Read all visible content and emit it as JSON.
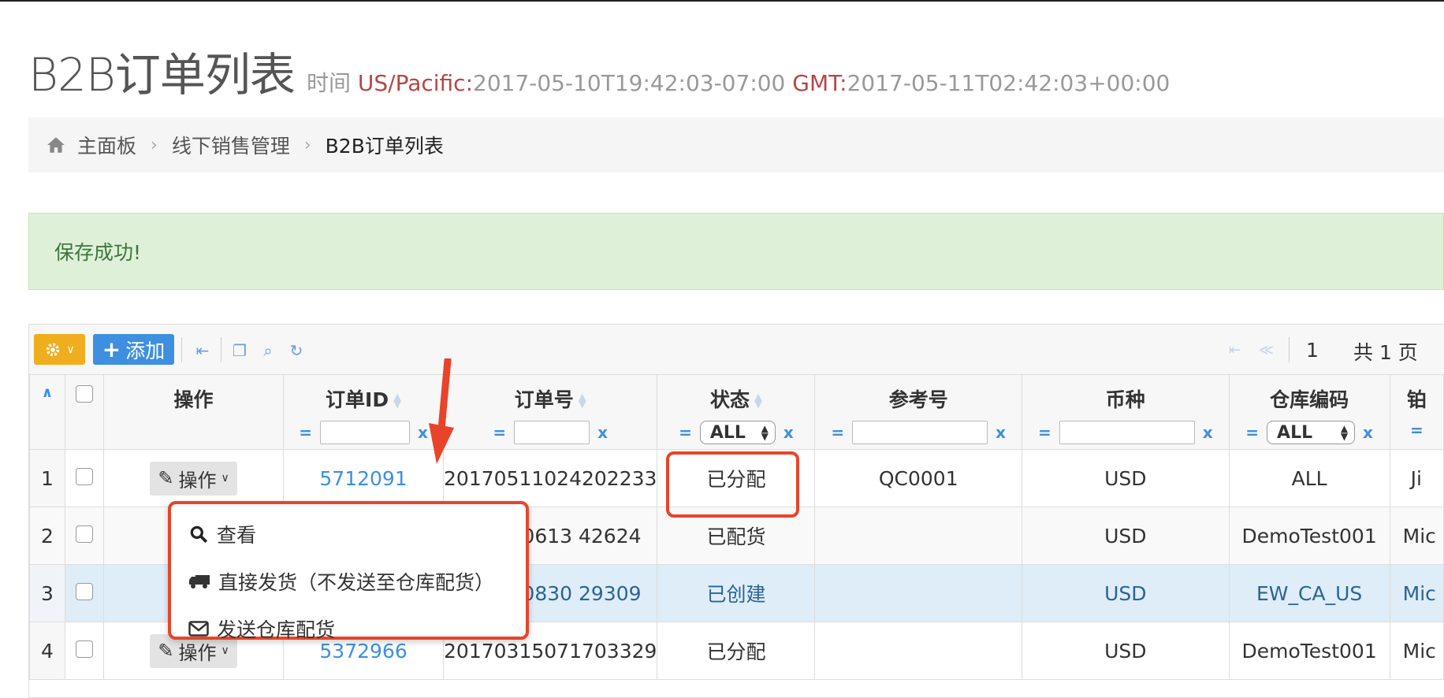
{
  "header": {
    "title": "B2B订单列表",
    "time_label": "时间",
    "tz1_label": "US/Pacific:",
    "tz1_value": "2017-05-10T19:42:03-07:00",
    "tz2_label": "GMT:",
    "tz2_value": "2017-05-11T02:42:03+00:00"
  },
  "breadcrumb": {
    "home": "主面板",
    "parent": "线下销售管理",
    "current": "B2B订单列表"
  },
  "alert": {
    "message": "保存成功!"
  },
  "toolbar": {
    "add_label": "添加",
    "page_number": "1",
    "page_total": "共 1 页"
  },
  "columns": {
    "ops": "操作",
    "order_id": "订单ID",
    "order_no": "订单号",
    "status": "状态",
    "ref_no": "参考号",
    "currency": "币种",
    "warehouse": "仓库编码",
    "next": "铂"
  },
  "filters": {
    "eq": "=",
    "clear": "x",
    "status_select": "ALL",
    "warehouse_select": "ALL"
  },
  "rows": [
    {
      "num": "1",
      "op": "操作",
      "order_id": "5712091",
      "order_no": "20170511024202233",
      "status": "已分配",
      "ref": "QC0001",
      "currency": "USD",
      "warehouse": "ALL",
      "next": "Ji"
    },
    {
      "num": "2",
      "op": "",
      "order_id": "",
      "order_no": "304200613 42624",
      "status": "已配货",
      "ref": "",
      "currency": "USD",
      "warehouse": "DemoTest001",
      "next": "Mic"
    },
    {
      "num": "3",
      "op": "",
      "order_id": "",
      "order_no": "304100830 29309",
      "status": "已创建",
      "ref": "",
      "currency": "USD",
      "warehouse": "EW_CA_US",
      "next": "Mic"
    },
    {
      "num": "4",
      "op": "操作",
      "order_id": "5372966",
      "order_no": "20170315071703329",
      "status": "已分配",
      "ref": "",
      "currency": "USD",
      "warehouse": "DemoTest001",
      "next": "Mic"
    }
  ],
  "dropdown": {
    "view": "查看",
    "ship_direct": "直接发货（不发送至仓库配货）",
    "send_warehouse": "发送仓库配货"
  },
  "colors": {
    "accent_blue": "#3e8fe0",
    "gear_orange": "#f0ad1e",
    "annotation_red": "#e8442a",
    "success_bg": "#dff0d8"
  }
}
